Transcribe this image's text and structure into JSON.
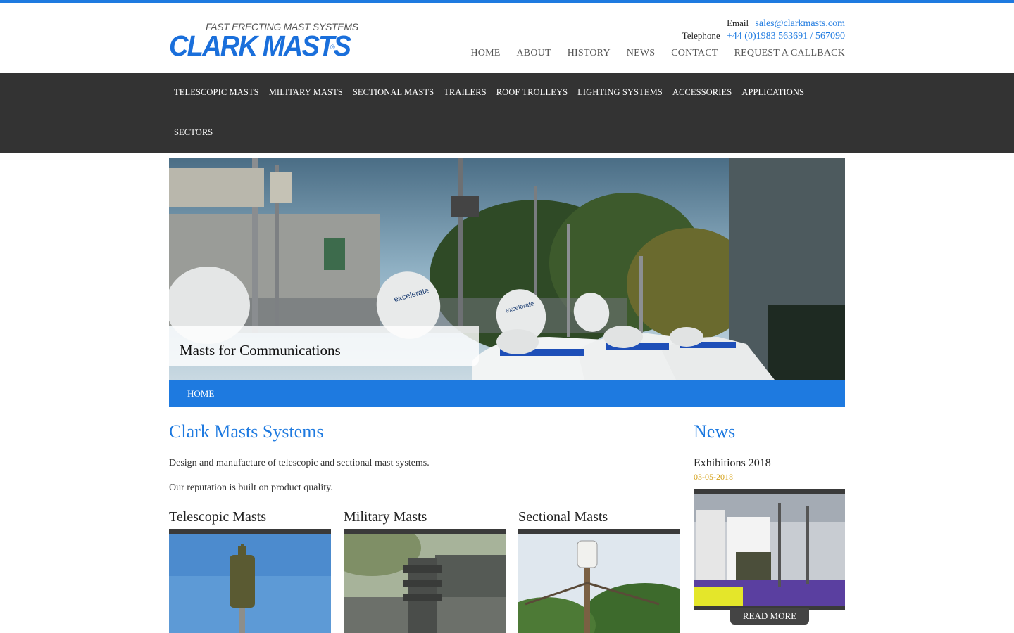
{
  "header": {
    "tagline": "FAST ERECTING MAST SYSTEMS",
    "brand": "CLARK MASTS",
    "registered_mark": "®",
    "email_label": "Email",
    "email_value": "sales@clarkmasts.com",
    "telephone_label": "Telephone",
    "telephone_value": "+44 (0)1983 563691 / 567090",
    "nav": [
      "HOME",
      "ABOUT",
      "HISTORY",
      "NEWS",
      "CONTACT",
      "REQUEST A CALLBACK"
    ]
  },
  "main_nav": [
    "TELESCOPIC MASTS",
    "MILITARY MASTS",
    "SECTIONAL MASTS",
    "TRAILERS",
    "ROOF TROLLEYS",
    "LIGHTING SYSTEMS",
    "ACCESSORIES",
    "APPLICATIONS",
    "SECTORS"
  ],
  "hero": {
    "caption": "Masts for Communications",
    "dish_label": "excelerate"
  },
  "breadcrumb": {
    "home": "HOME"
  },
  "content": {
    "title": "Clark Masts Systems",
    "paragraphs": [
      "Design and manufacture of telescopic and sectional mast systems.",
      "Our reputation is built on product quality."
    ],
    "cards": [
      {
        "title": "Telescopic Masts"
      },
      {
        "title": "Military Masts"
      },
      {
        "title": "Sectional Masts"
      }
    ]
  },
  "news": {
    "title": "News",
    "item_title": "Exhibitions 2018",
    "item_date": "03-05-2018",
    "read_more": "READ MORE"
  },
  "colors": {
    "accent_blue": "#1e7ae0",
    "nav_dark": "#333333",
    "date_gold": "#d4a017"
  }
}
